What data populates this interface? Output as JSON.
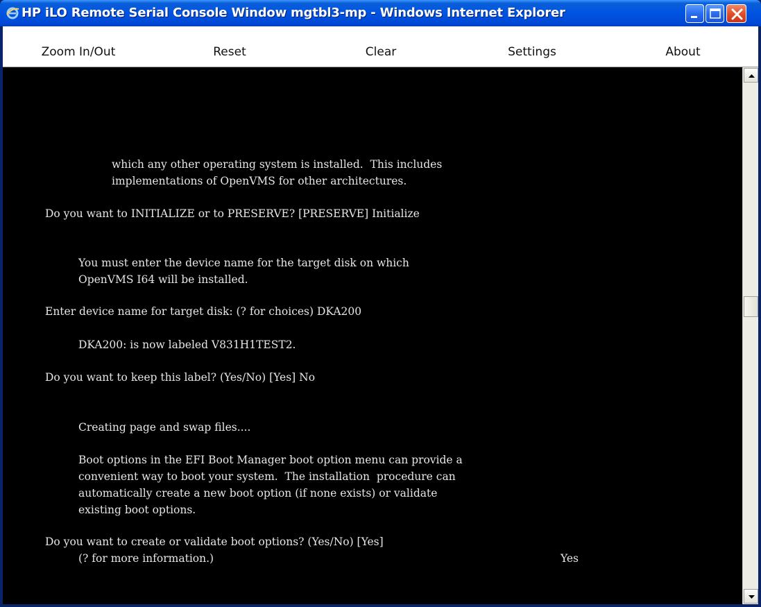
{
  "window": {
    "title": "HP iLO Remote Serial Console Window mgtbl3-mp - Windows Internet Explorer",
    "app_icon": "ie-icon",
    "buttons": [
      "minimize-icon",
      "maximize-icon",
      "close-icon"
    ]
  },
  "menu": {
    "zoom": "Zoom In/Out",
    "reset": "Reset",
    "clear": "Clear",
    "settings": "Settings",
    "about": "About"
  },
  "console": {
    "lines": [
      "which any other operating system is installed.  This includes",
      "implementations of OpenVMS for other architectures.",
      "Do you want to INITIALIZE or to PRESERVE? [PRESERVE] Initialize",
      "You must enter the device name for the target disk on which",
      "OpenVMS I64 will be installed.",
      "Enter device name for target disk: (? for choices) DKA200",
      "DKA200: is now labeled V831H1TEST2.",
      "Do you want to keep this label? (Yes/No) [Yes] No",
      "Creating page and swap files....",
      "Boot options in the EFI Boot Manager boot option menu can provide a",
      "convenient way to boot your system.  The installation  procedure can",
      "automatically create a new boot option (if none exists) or validate",
      "existing boot options.",
      "Do you want to create or validate boot options? (Yes/No) [Yes]",
      "(? for more information.)",
      "Yes"
    ]
  },
  "colors": {
    "titlebar": "#0053e1",
    "console_bg": "#000000",
    "console_fg": "#e6e6e6",
    "close_button": "#e0502b"
  }
}
